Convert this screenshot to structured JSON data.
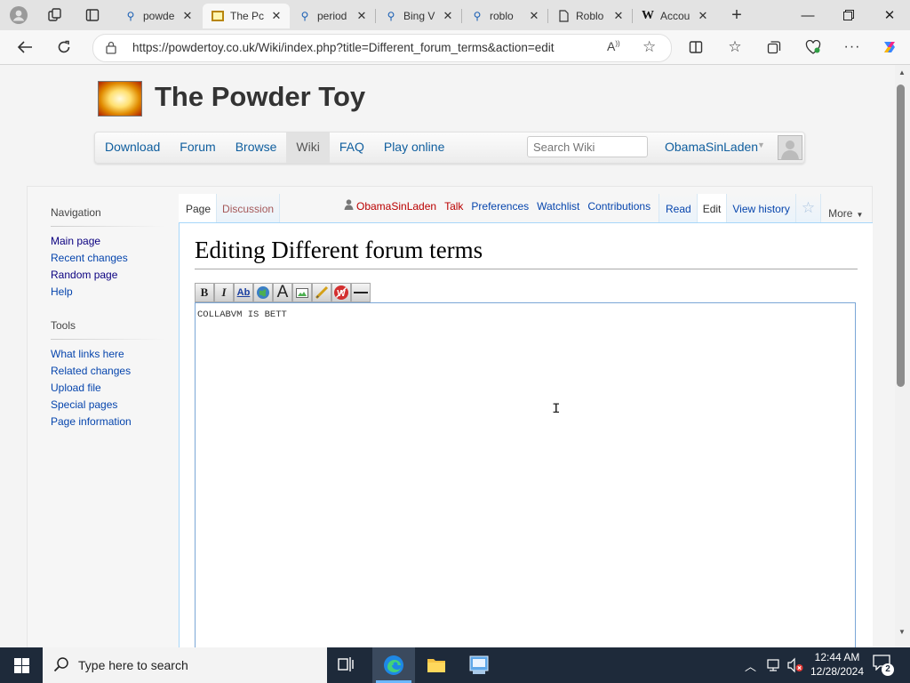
{
  "browser": {
    "tabs": [
      {
        "title": "powde",
        "icon": "search-icon"
      },
      {
        "title": "The Pc",
        "icon": "powder-toy-favicon",
        "active": true
      },
      {
        "title": "period",
        "icon": "search-icon"
      },
      {
        "title": "Bing V",
        "icon": "search-icon"
      },
      {
        "title": "roblo",
        "icon": "search-icon"
      },
      {
        "title": "Roblo",
        "icon": "page-icon"
      },
      {
        "title": "Accou",
        "icon": "wikipedia-icon"
      }
    ],
    "url": "https://powdertoy.co.uk/Wiki/index.php?title=Different_forum_terms&action=edit"
  },
  "site": {
    "title": "The Powder Toy",
    "nav": [
      "Download",
      "Forum",
      "Browse",
      "Wiki",
      "FAQ",
      "Play online"
    ],
    "active_nav": "Wiki",
    "search_placeholder": "Search Wiki",
    "username": "ObamaSinLaden"
  },
  "wiki": {
    "sidebar": {
      "nav_heading": "Navigation",
      "nav_links": [
        "Main page",
        "Recent changes",
        "Random page",
        "Help"
      ],
      "tools_heading": "Tools",
      "tool_links": [
        "What links here",
        "Related changes",
        "Upload file",
        "Special pages",
        "Page information"
      ]
    },
    "tabs_left": [
      "Page",
      "Discussion"
    ],
    "personal": {
      "user": "ObamaSinLaden",
      "links": [
        "Talk",
        "Preferences",
        "Watchlist",
        "Contributions"
      ]
    },
    "views": [
      "Read",
      "Edit",
      "View history"
    ],
    "more_label": "More",
    "heading": "Editing Different forum terms",
    "editor_text": "COLLABVM IS BETT"
  },
  "taskbar": {
    "search_placeholder": "Type here to search",
    "time": "12:44 AM",
    "date": "12/28/2024",
    "notification_count": "2"
  }
}
